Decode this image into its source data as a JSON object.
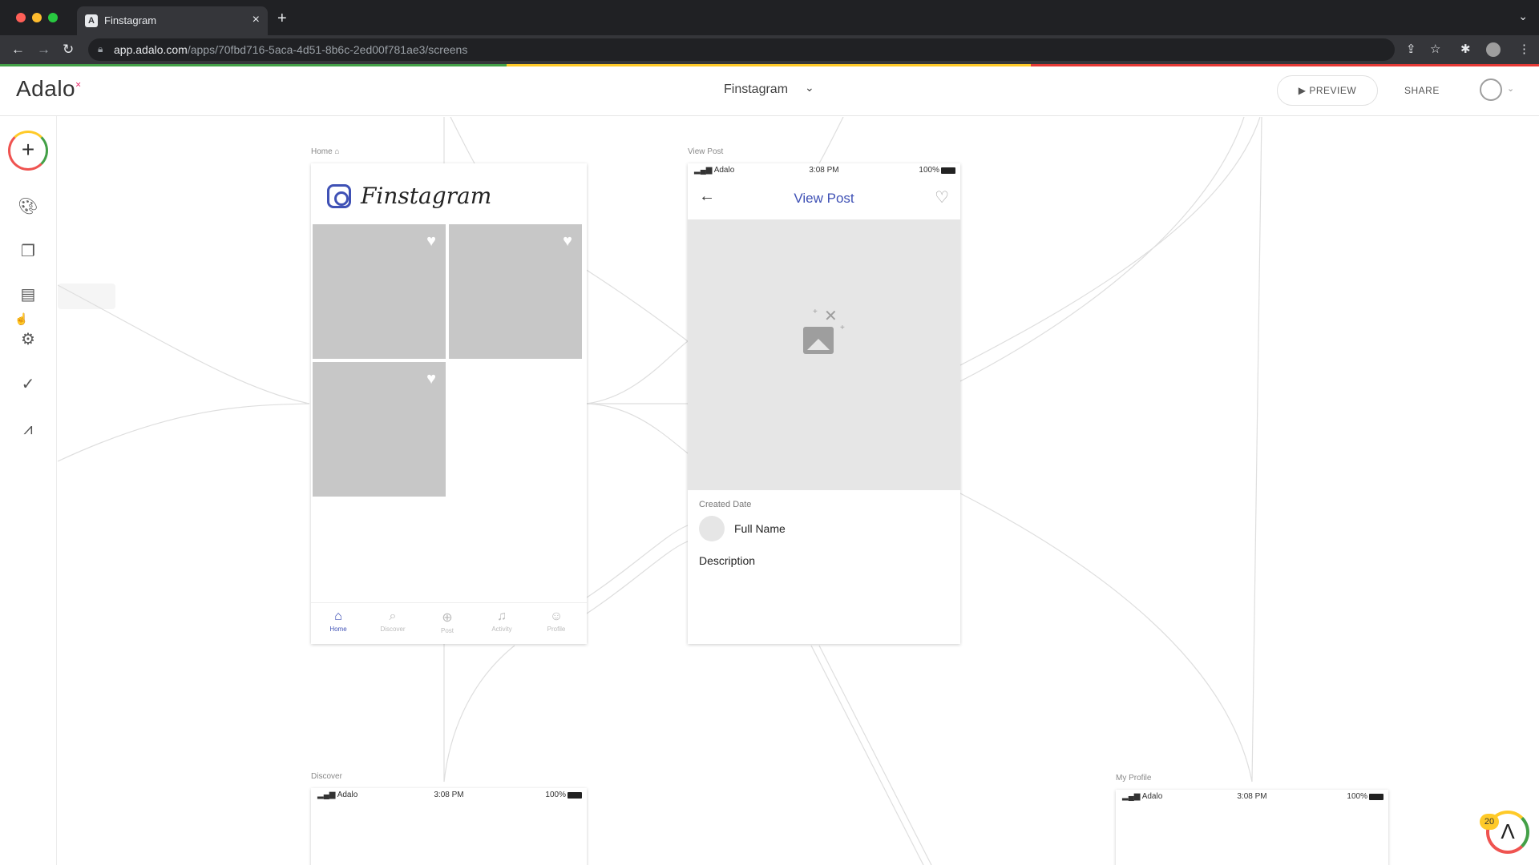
{
  "browser": {
    "tab_title": "Finstagram",
    "tab_favicon": "A",
    "tab_close": "×",
    "new_tab": "+",
    "tab_menu": "⌄",
    "url_host": "app.adalo.com",
    "url_path": "/apps/70fbd716-5aca-4d51-8b6c-2ed00f781ae3/screens",
    "progress_colors": [
      "#43a047",
      "#ffca28",
      "#e53935"
    ]
  },
  "header": {
    "logo": "Adalo",
    "app_name": "Finstagram",
    "preview_label": "▶ PREVIEW",
    "share_label": "SHARE"
  },
  "screens": {
    "home": {
      "label": "Home",
      "title": "Finstagram",
      "nav": [
        {
          "label": "Home",
          "icon": "home-icon",
          "glyph": "⌂"
        },
        {
          "label": "Discover",
          "icon": "search-icon",
          "glyph": "⌕"
        },
        {
          "label": "Post",
          "icon": "plus-circle-icon",
          "glyph": "⊕"
        },
        {
          "label": "Activity",
          "icon": "bell-icon",
          "glyph": "♫"
        },
        {
          "label": "Profile",
          "icon": "person-circle-icon",
          "glyph": "☺"
        }
      ]
    },
    "view_post": {
      "label": "View Post",
      "status_carrier": "Adalo",
      "status_time": "3:08 PM",
      "status_battery": "100%",
      "title": "View Post",
      "created_date": "Created Date",
      "full_name": "Full Name",
      "description": "Description"
    },
    "discover": {
      "label": "Discover",
      "status_carrier": "Adalo",
      "status_time": "3:08 PM",
      "status_battery": "100%"
    },
    "my_profile": {
      "label": "My Profile",
      "status_carrier": "Adalo",
      "status_time": "3:08 PM",
      "status_battery": "100%"
    }
  },
  "help": {
    "count": "20"
  }
}
